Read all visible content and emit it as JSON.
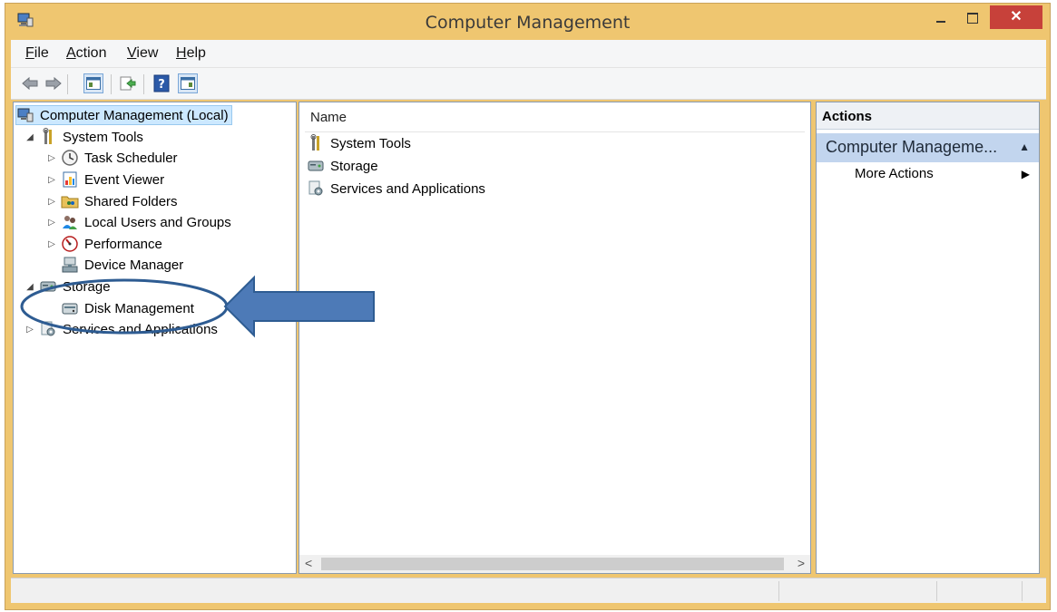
{
  "window": {
    "title": "Computer Management",
    "close_glyph": "✕"
  },
  "menu": [
    {
      "label": "File"
    },
    {
      "label": "Action"
    },
    {
      "label": "View"
    },
    {
      "label": "Help"
    }
  ],
  "toolbar": {
    "buttons": [
      "back-icon",
      "forward-icon",
      "show-hide-console-tree-icon",
      "export-list-icon",
      "help-icon",
      "show-hide-action-pane-icon"
    ]
  },
  "tree": {
    "root": "Computer Management (Local)",
    "system_tools": "System Tools",
    "task_scheduler": "Task Scheduler",
    "event_viewer": "Event Viewer",
    "shared_folders": "Shared Folders",
    "local_users": "Local Users and Groups",
    "performance": "Performance",
    "device_manager": "Device Manager",
    "storage": "Storage",
    "disk_management": "Disk Management",
    "services": "Services and Applications"
  },
  "center": {
    "column_name": "Name",
    "items": [
      "System Tools",
      "Storage",
      "Services and Applications"
    ]
  },
  "actions": {
    "header": "Actions",
    "section": "Computer Manageme...",
    "more_actions": "More Actions"
  },
  "colors": {
    "title_bar": "#efc670",
    "close_button": "#c7413a",
    "annotation": "#2e5c92",
    "arrow_fill": "#4d7ab7"
  }
}
